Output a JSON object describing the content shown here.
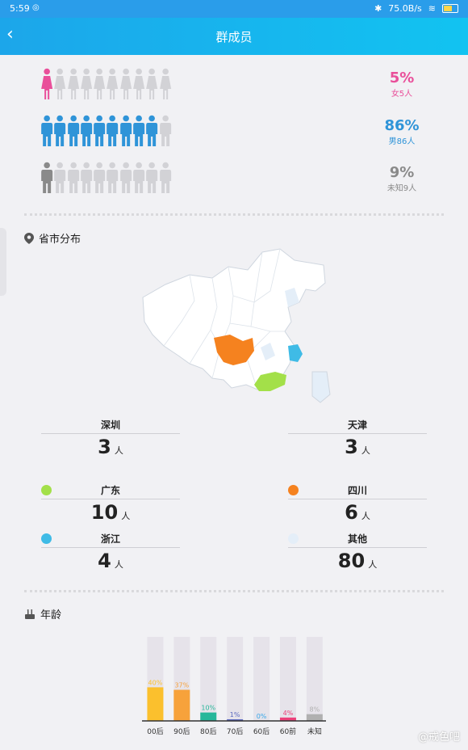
{
  "status": {
    "time": "5:59",
    "speed": "75.0B/s"
  },
  "header": {
    "title": "群成员"
  },
  "gender": [
    {
      "percent": "5%",
      "label": "女5人",
      "color": "#e94f9a",
      "filled": 1,
      "icon": "female-icon"
    },
    {
      "percent": "86%",
      "label": "男86人",
      "color": "#2f94d8",
      "filled": 9,
      "icon": "male-icon"
    },
    {
      "percent": "9%",
      "label": "未知9人",
      "color": "#8a8a8a",
      "filled": 1,
      "icon": "unknown-person-icon"
    }
  ],
  "region": {
    "title": "省市分布",
    "stats": [
      {
        "name": "深圳",
        "value": "3",
        "unit": "人"
      },
      {
        "name": "天津",
        "value": "3",
        "unit": "人"
      },
      {
        "name": "广东",
        "value": "10",
        "unit": "人",
        "color": "#a3e049"
      },
      {
        "name": "四川",
        "value": "6",
        "unit": "人",
        "color": "#f5821f"
      },
      {
        "name": "浙江",
        "value": "4",
        "unit": "人",
        "color": "#3fbbe6"
      },
      {
        "name": "其他",
        "value": "80",
        "unit": "人",
        "color": "#e4eef8"
      }
    ]
  },
  "age": {
    "title": "年龄",
    "chart_data": {
      "type": "bar",
      "categories": [
        "00后",
        "90后",
        "80后",
        "70后",
        "60后",
        "60前",
        "未知"
      ],
      "values": [
        40,
        37,
        10,
        1,
        0,
        4,
        8
      ],
      "labels": [
        "40%",
        "37%",
        "10%",
        "1%",
        "0%",
        "4%",
        "8%"
      ],
      "colors": [
        "#fbc02d",
        "#f7a23b",
        "#26b79a",
        "#5c6bc0",
        "#3aa8e8",
        "#ec407a",
        "#b0b0b0"
      ],
      "ylim": [
        0,
        100
      ]
    }
  },
  "watermark": "@戒色吧"
}
